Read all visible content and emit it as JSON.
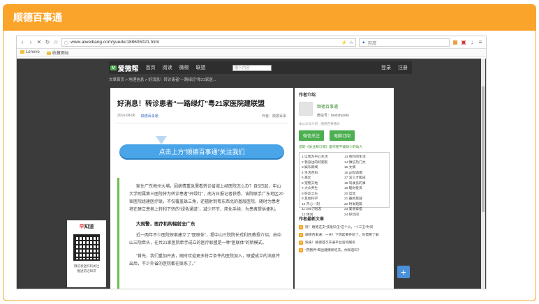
{
  "card": {
    "title": "顺德百事通"
  },
  "browser": {
    "url": "www.aiweibang.com/yuedu/188605021.html",
    "search_engine": "百度",
    "bookmarks": [
      "Lenovo",
      "收藏图标"
    ]
  },
  "site": {
    "logo_text": "爱微帮",
    "logo_badge": "V",
    "nav": [
      "首页",
      "阅读",
      "微榜",
      "联盟"
    ],
    "search_placeholder": "输入内容",
    "login": "登录",
    "register": "注册",
    "breadcrumb": "文章首页 > 地理信息 > 好消息！转诊患者“一路绿灯”粤21家医..."
  },
  "article": {
    "title": "好消息！转诊患者“一路绿灯”粤21家医院建联盟",
    "date": "2016-08-06",
    "source": "顺德百事通",
    "author": "作者：顺德百事",
    "banner": "点击上方“顺德百事通”关注我们",
    "paragraphs": [
      "家住广东梅州大埔，因病情重急需看转诊省城上经医院怎么办？自5日起，中山大学附属第三医院将为转诊患者“开绿灯”，南方日报记者获悉，该院联手广东地区20家医院组建医疗联，不仅覆盖珠三角，还辐射到粤东西北的基层医院，随时为患者将在建立患者上转和下转的“绿色通道”，减少环节，简化手续，为患者提供便利。",
      "大规警，医疗机构辐射全广东",
      "近一两年不少医院探索建立了“医联体”，提中山三院院长戎利民教授介绍，由中山三院牵头，在共21家医院牵手成立的医疗联盟是一种“医联体”的新模式。",
      "“首先，我们重加开放，随时欢迎更多符合条件的医院加入，联盟成立的消息传出后，不少外省的医院都在联系了。”"
    ]
  },
  "sidebar": {
    "intro_title": "作者介绍",
    "account_name": "顺德百事通",
    "wechat_id": "微信号：bestshunde",
    "intro": "本公众号介绍：顺德百事通同",
    "follow_btn": "微信关注",
    "subscribe_btn": "电脑订阅",
    "rank_link": "您的《关注和订阅》是作者不能缺少的动力",
    "rank_left": [
      "1 以我为中心生活",
      "2 我身边的好朋友",
      "3 娱乐新闻",
      "4 生活百科",
      "5 美女",
      "6 宠物天地",
      "7 大众养生",
      "8 好友之乐",
      "9 其他科学",
      "10 开心一刻",
      "11 200万股友",
      "12 休闲"
    ],
    "rank_right": [
      "13 有料的生活",
      "14 微信热门文",
      "15 文摘",
      "16 gif动态图",
      "17 怎么才能成",
      "18 驾驶员的事",
      "19 理财投资",
      "20 运动",
      "21 最新旅游",
      "22 时尚短篇",
      "23 美丽穿搭",
      "24 好玩的"
    ],
    "hot_title": "作者最新文章",
    "hot": [
      "厉！顺德这支“技能队伍”这个火，“十三五”时间",
      "顺德百事通：一天！下周起要开始了，你需要了解",
      "快来！顺德首次开通平台咨询服务",
      "“药膳养”喝出健康新吃法，你知道吗？"
    ]
  },
  "qr": {
    "title_accent": "早",
    "title_rest": "知道",
    "desc1": "微信发送扫码关注",
    "desc2": "推送前沿知识"
  },
  "float_button": "+"
}
